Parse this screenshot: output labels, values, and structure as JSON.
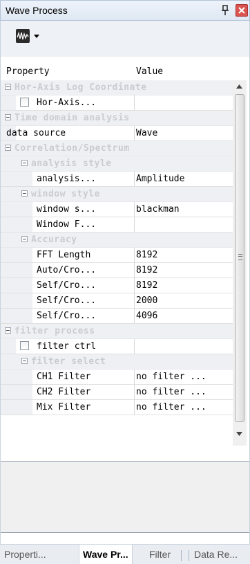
{
  "window": {
    "title": "Wave Process",
    "pin_icon": "pin-icon",
    "close_icon": "close-icon"
  },
  "toolbar": {
    "icon": "waveform-icon",
    "dropdown_icon": "chevron-down-icon"
  },
  "grid": {
    "header": {
      "property": "Property",
      "value": "Value"
    },
    "rows": [
      {
        "kind": "cat",
        "level": 0,
        "label": "Hor-Axis Log Coordinate"
      },
      {
        "kind": "prop",
        "level": 1,
        "label": "Hor-Axis...",
        "value": "",
        "checkbox": true,
        "checked": false
      },
      {
        "kind": "cat",
        "level": 0,
        "label": "Time domain analysis"
      },
      {
        "kind": "prop",
        "level": 1,
        "label": "data source",
        "value": "Wave"
      },
      {
        "kind": "cat",
        "level": 0,
        "label": "Correlation/Spectrum"
      },
      {
        "kind": "cat",
        "level": 1,
        "label": "analysis style"
      },
      {
        "kind": "prop",
        "level": 2,
        "label": "analysis...",
        "value": "Amplitude"
      },
      {
        "kind": "cat",
        "level": 1,
        "label": "window style"
      },
      {
        "kind": "prop",
        "level": 2,
        "label": "window s...",
        "value": "blackman"
      },
      {
        "kind": "prop",
        "level": 2,
        "label": "Window F...",
        "value": ""
      },
      {
        "kind": "cat",
        "level": 1,
        "label": "Accuracy"
      },
      {
        "kind": "prop",
        "level": 2,
        "label": "FFT Length",
        "value": "8192"
      },
      {
        "kind": "prop",
        "level": 2,
        "label": "Auto/Cro...",
        "value": "8192"
      },
      {
        "kind": "prop",
        "level": 2,
        "label": "Self/Cro...",
        "value": "8192"
      },
      {
        "kind": "prop",
        "level": 2,
        "label": "Self/Cro...",
        "value": "2000"
      },
      {
        "kind": "prop",
        "level": 2,
        "label": "Self/Cro...",
        "value": "4096"
      },
      {
        "kind": "cat",
        "level": 0,
        "label": "filter process"
      },
      {
        "kind": "prop",
        "level": 1,
        "label": "filter ctrl",
        "value": "",
        "checkbox": true,
        "checked": false
      },
      {
        "kind": "cat",
        "level": 1,
        "label": "filter select"
      },
      {
        "kind": "prop",
        "level": 2,
        "label": "CH1 Filter",
        "value": "no filter ..."
      },
      {
        "kind": "prop",
        "level": 2,
        "label": "CH2 Filter",
        "value": "no filter ..."
      },
      {
        "kind": "prop",
        "level": 2,
        "label": "Mix Filter",
        "value": "no filter ..."
      }
    ]
  },
  "description": {
    "text": ""
  },
  "tabs": [
    {
      "label": "Properti...",
      "active": false
    },
    {
      "label": "Wave Pr...",
      "active": true
    },
    {
      "label": "Filter",
      "active": false
    },
    {
      "label": "Data Re...",
      "active": false
    }
  ],
  "colors": {
    "category_text": "#c9ccd2",
    "category_bg": "#eef0f3",
    "title_bg": "#dfe8f3",
    "close_red": "#d9534f"
  }
}
